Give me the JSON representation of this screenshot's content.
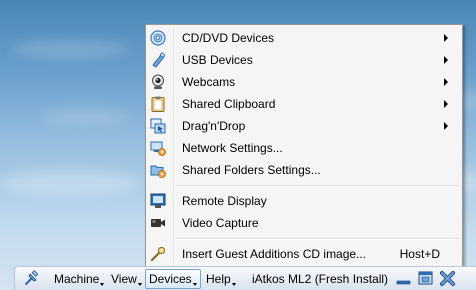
{
  "menu": {
    "items": [
      {
        "label": "CD/DVD Devices",
        "icon": "cd-icon",
        "submenu": true
      },
      {
        "label": "USB Devices",
        "icon": "usb-icon",
        "submenu": true
      },
      {
        "label": "Webcams",
        "icon": "webcam-icon",
        "submenu": true
      },
      {
        "label": "Shared Clipboard",
        "icon": "clipboard-icon",
        "submenu": true
      },
      {
        "label": "Drag'n'Drop",
        "icon": "drag-drop-icon",
        "submenu": true
      },
      {
        "label": "Network Settings...",
        "icon": "network-settings-icon",
        "submenu": false
      },
      {
        "label": "Shared Folders Settings...",
        "icon": "shared-folders-icon",
        "submenu": false
      },
      {
        "label": "Remote Display",
        "icon": "remote-display-icon",
        "submenu": false
      },
      {
        "label": "Video Capture",
        "icon": "video-capture-icon",
        "submenu": false
      },
      {
        "label": "Insert Guest Additions CD image...",
        "icon": "guest-additions-icon",
        "submenu": false,
        "shortcut": "Host+D"
      }
    ]
  },
  "menubar": {
    "items": [
      "Machine",
      "View",
      "Devices",
      "Help"
    ],
    "active": "Devices",
    "vm_title": "iAtkos ML2 (Fresh Install)"
  },
  "colors": {
    "menu_bg": "#f5f5f5",
    "menubar_active": "#dbe9f8",
    "desktop_sky": "#6a9fcc"
  }
}
